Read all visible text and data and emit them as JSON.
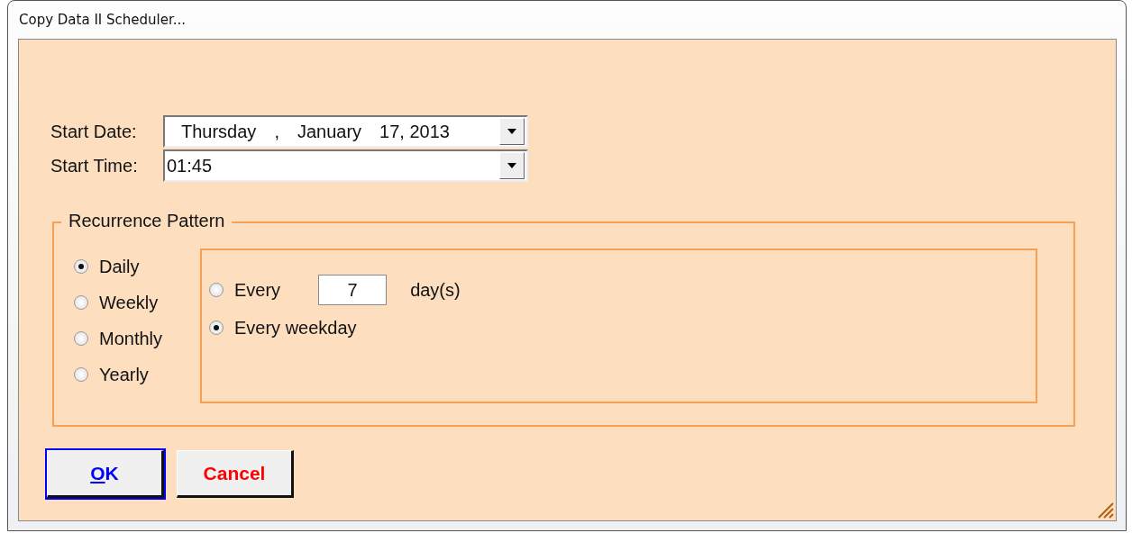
{
  "window": {
    "title": "Copy Data II Scheduler..."
  },
  "start_date": {
    "label": "Start Date:",
    "segments": [
      "Thursday",
      ",",
      "January",
      "17, 2013"
    ]
  },
  "start_time": {
    "label": "Start Time:",
    "value": "01:45"
  },
  "recurrence": {
    "title": "Recurrence Pattern",
    "frequencies": [
      {
        "label": "Daily",
        "selected": true
      },
      {
        "label": "Weekly",
        "selected": false
      },
      {
        "label": "Monthly",
        "selected": false
      },
      {
        "label": "Yearly",
        "selected": false
      }
    ],
    "daily_options": [
      {
        "kind": "interval",
        "label": "Every",
        "value": "7",
        "unit": "day(s)",
        "selected": false
      },
      {
        "kind": "plain",
        "label": "Every weekday",
        "selected": true
      }
    ]
  },
  "buttons": [
    {
      "label": "OK",
      "default": true,
      "underline_first": true,
      "color": "#0000ff"
    },
    {
      "label": "Cancel",
      "default": false,
      "underline_first": false,
      "color": "#ff0000"
    }
  ]
}
